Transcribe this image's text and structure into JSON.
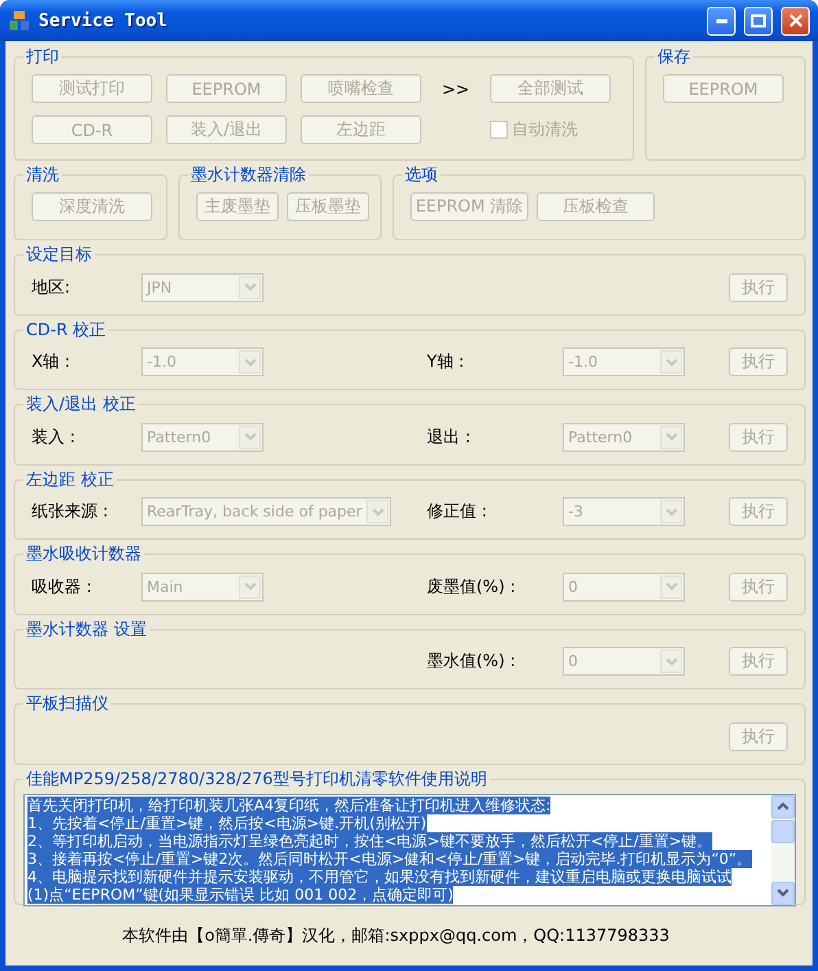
{
  "window": {
    "title": "Service Tool"
  },
  "print_group": {
    "title": "打印",
    "buttons": [
      {
        "label": "测试打印",
        "disabled": true
      },
      {
        "label": "EEPROM",
        "disabled": true
      },
      {
        "label": "喷嘴检查",
        "disabled": true
      },
      {
        "label": "CD-R",
        "disabled": true
      },
      {
        "label": "装入/退出",
        "disabled": true
      },
      {
        "label": "左边距",
        "disabled": true
      }
    ],
    "arrow": ">>",
    "run_all": {
      "label": "全部测试",
      "disabled": true
    },
    "auto_clean": {
      "label": "自动清洗",
      "checked": false,
      "disabled": true
    }
  },
  "save_group": {
    "title": "保存",
    "buttons": [
      {
        "label": "EEPROM",
        "disabled": true
      }
    ]
  },
  "button_groups": [
    {
      "title": "清洗",
      "buttons": [
        {
          "label": "深度清洗",
          "disabled": true
        }
      ]
    },
    {
      "title": "墨水计数器清除",
      "buttons": [
        {
          "label": "主废墨垫",
          "disabled": true
        },
        {
          "label": "压板墨垫",
          "disabled": true
        }
      ]
    },
    {
      "title": "选项",
      "buttons": [
        {
          "label": "EEPROM 清除",
          "disabled": true
        },
        {
          "label": "压板检查",
          "disabled": true
        }
      ]
    }
  ],
  "sections": [
    {
      "title": "设定目标",
      "left": {
        "label": "地区:",
        "value": "JPN",
        "disabled": true
      },
      "button": {
        "label": "执行",
        "disabled": true
      }
    },
    {
      "title": "CD-R 校正",
      "left": {
        "label": "X轴 :",
        "value": "-1.0",
        "disabled": true
      },
      "right": {
        "label": "Y轴 :",
        "value": "-1.0",
        "disabled": true
      },
      "button": {
        "label": "执行",
        "disabled": true
      }
    },
    {
      "title": "装入/退出 校正",
      "left": {
        "label": "装入 :",
        "value": "Pattern0",
        "disabled": true
      },
      "right": {
        "label": "退出 :",
        "value": "Pattern0",
        "disabled": true
      },
      "button": {
        "label": "执行",
        "disabled": true
      }
    },
    {
      "title": "左边距 校正",
      "left": {
        "label": "纸张来源 :",
        "value": "RearTray, back side of paper",
        "disabled": true,
        "wide": true
      },
      "right": {
        "label": "修正值 :",
        "value": "-3",
        "disabled": true
      },
      "button": {
        "label": "执行",
        "disabled": true
      }
    },
    {
      "title": "墨水吸收计数器",
      "left": {
        "label": "吸收器 :",
        "value": "Main",
        "disabled": true
      },
      "right": {
        "label": "废墨值(%) :",
        "value": "0",
        "disabled": true
      },
      "button": {
        "label": "执行",
        "disabled": true
      }
    },
    {
      "title": "墨水计数器 设置",
      "right": {
        "label": "墨水值(%) :",
        "value": "0",
        "disabled": true
      },
      "button": {
        "label": "执行",
        "disabled": true
      }
    },
    {
      "title": "平板扫描仪",
      "button": {
        "label": "执行",
        "disabled": true
      }
    }
  ],
  "instructions": {
    "title": "佳能MP259/258/2780/328/276型号打印机清零软件使用说明",
    "selected": true,
    "lines": [
      "首先关闭打印机，给打印机装几张A4复印纸，然后准备让打印机进入维修状态:",
      "1、先按着<停止/重置>键，然后按<电源>键.开机(别松开)",
      "2、等打印机启动，当电源指示灯呈绿色亮起时，按住<电源>键不要放手，然后松开<停止/重置>键。",
      "3、接着再按<停止/重置>键2次。然后同时松开<电源>健和<停止/重置>键，启动完毕.打印机显示为“0”。",
      "4、电脑提示找到新硬件并提示安装驱动，不用管它，如果没有找到新硬件，建议重启电脑或更换电脑试试",
      "(1)点“EEPROM”键(如果显示错误  比如 001  002，点确定即可)"
    ]
  },
  "footer": "本软件由【o簡單.傳奇】汉化，邮箱:sxppx@qq.com，QQ:1137798333"
}
